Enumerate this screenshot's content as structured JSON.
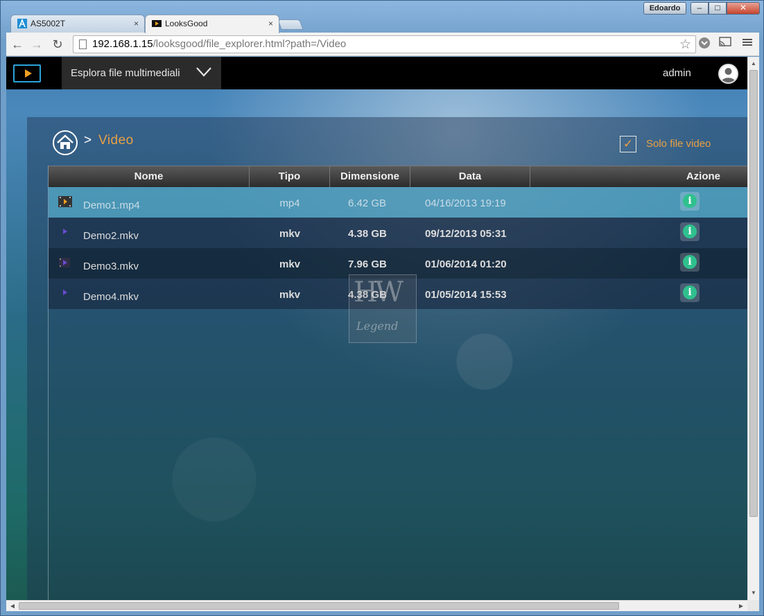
{
  "window": {
    "user_label": "Edoardo",
    "minimize": "–",
    "maximize": "□",
    "close": "✕"
  },
  "tabs": [
    {
      "title": "AS5002T",
      "close": "×"
    },
    {
      "title": "LooksGood",
      "close": "×"
    }
  ],
  "toolbar": {
    "back": "←",
    "forward": "→",
    "reload": "↻",
    "url_host": "192.168.1.15",
    "url_path": "/looksgood/file_explorer.html?path=/Video",
    "star": "☆"
  },
  "appbar": {
    "menu_label": "Esplora file multimediali",
    "user_name": "admin"
  },
  "breadcrumb": {
    "separator": ">",
    "current": "Video"
  },
  "filter": {
    "checkmark": "✓",
    "label": "Solo file video",
    "checked": true
  },
  "table": {
    "headers": {
      "name": "Nome",
      "type": "Tipo",
      "size": "Dimensione",
      "date": "Data",
      "action": "Azione"
    },
    "rows": [
      {
        "name": "Demo1.mp4",
        "type": "mp4",
        "size": "6.42  GB",
        "date": "04/16/2013 19:19",
        "action_icon": "info-icon",
        "selected": true
      },
      {
        "name": "Demo2.mkv",
        "type": "mkv",
        "size": "4.38  GB",
        "date": "09/12/2013 05:31",
        "action_icon": "info-icon"
      },
      {
        "name": "Demo3.mkv",
        "type": "mkv",
        "size": "7.96  GB",
        "date": "01/06/2014 01:20",
        "action_icon": "info-icon"
      },
      {
        "name": "Demo4.mkv",
        "type": "mkv",
        "size": "4.38  GB",
        "date": "01/05/2014 15:53",
        "action_icon": "info-icon"
      }
    ],
    "info_glyph": "i"
  },
  "watermark": {
    "main": "HW",
    "sub": "Legend"
  },
  "colors": {
    "accent_orange": "#e8a044",
    "info_green": "#2fc08e",
    "selected_row": "#55aac8",
    "appbar": "#000000"
  }
}
